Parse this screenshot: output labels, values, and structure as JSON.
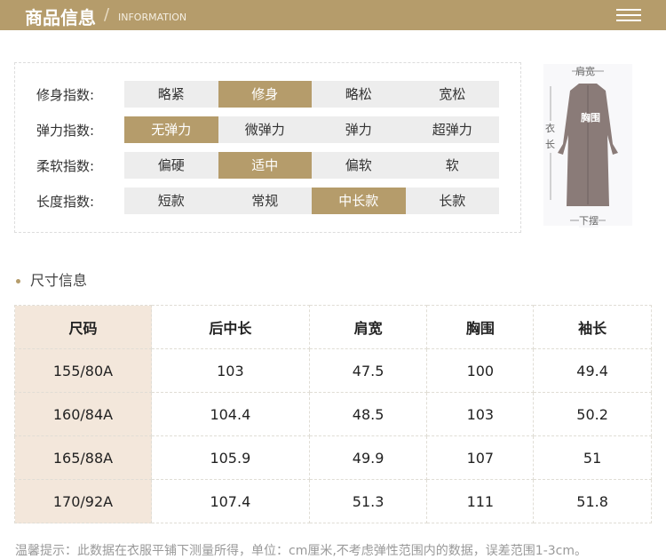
{
  "header": {
    "title": "商品信息",
    "subtitle": "INFORMATION",
    "menu_icon": "menu-icon"
  },
  "indices": [
    {
      "label": "修身指数:",
      "options": [
        "略紧",
        "修身",
        "略松",
        "宽松"
      ],
      "selected": 1
    },
    {
      "label": "弹力指数:",
      "options": [
        "无弹力",
        "微弹力",
        "弹力",
        "超弹力"
      ],
      "selected": 0
    },
    {
      "label": "柔软指数:",
      "options": [
        "偏硬",
        "适中",
        "偏软",
        "软"
      ],
      "selected": 1
    },
    {
      "label": "长度指数:",
      "options": [
        "短款",
        "常规",
        "中长款",
        "长款"
      ],
      "selected": 2
    }
  ],
  "diagram": {
    "shoulder": "肩宽",
    "chest": "胸围",
    "length": "衣长",
    "hem": "下摆"
  },
  "size_section": {
    "title": "尺寸信息"
  },
  "size_table": {
    "headers": [
      "尺码",
      "后中长",
      "肩宽",
      "胸围",
      "袖长"
    ],
    "rows": [
      [
        "155/80A",
        "103",
        "47.5",
        "100",
        "49.4"
      ],
      [
        "160/84A",
        "104.4",
        "48.5",
        "103",
        "50.2"
      ],
      [
        "165/88A",
        "105.9",
        "49.9",
        "107",
        "51"
      ],
      [
        "170/92A",
        "107.4",
        "51.3",
        "111",
        "51.8"
      ]
    ]
  },
  "note": "温馨提示：此数据在衣服平铺下测量所得，单位：cm厘米,不考虑弹性范围内的数据，误差范围1-3cm。",
  "colors": {
    "accent": "#b59c6b",
    "cell": "#ededed",
    "first_col": "#f3e7db"
  }
}
